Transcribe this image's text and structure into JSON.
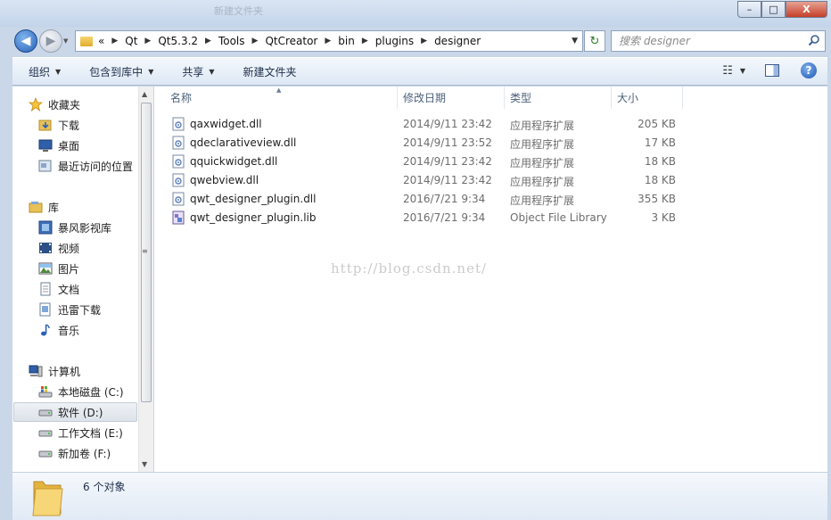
{
  "window": {
    "ghost_title": "新建文件夹",
    "minimize": "–",
    "maximize": "□",
    "close": "X"
  },
  "nav": {
    "back": "◀",
    "forward": "▶",
    "refresh": "↻",
    "crumbs": [
      "Qt",
      "Qt5.3.2",
      "Tools",
      "QtCreator",
      "bin",
      "plugins",
      "designer"
    ],
    "overflow": "«"
  },
  "search": {
    "placeholder": "搜索 designer"
  },
  "toolbar": {
    "organize": "组织",
    "include_in_library": "包含到库中",
    "share": "共享",
    "new_folder": "新建文件夹"
  },
  "sidebar": {
    "favorites_label": "收藏夹",
    "favorites": [
      "下载",
      "桌面",
      "最近访问的位置"
    ],
    "libraries_label": "库",
    "libraries": [
      "暴风影视库",
      "视频",
      "图片",
      "文档",
      "迅雷下载",
      "音乐"
    ],
    "computer_label": "计算机",
    "drives": [
      "本地磁盘 (C:)",
      "软件 (D:)",
      "工作文档 (E:)",
      "新加卷 (F:)"
    ]
  },
  "columns": {
    "name": "名称",
    "date": "修改日期",
    "type": "类型",
    "size": "大小"
  },
  "files": [
    {
      "name": "qaxwidget.dll",
      "date": "2014/9/11 23:42",
      "type": "应用程序扩展",
      "size": "205 KB",
      "icon": "dll-file-icon"
    },
    {
      "name": "qdeclarativeview.dll",
      "date": "2014/9/11 23:52",
      "type": "应用程序扩展",
      "size": "17 KB",
      "icon": "dll-file-icon"
    },
    {
      "name": "qquickwidget.dll",
      "date": "2014/9/11 23:42",
      "type": "应用程序扩展",
      "size": "18 KB",
      "icon": "dll-file-icon"
    },
    {
      "name": "qwebview.dll",
      "date": "2014/9/11 23:42",
      "type": "应用程序扩展",
      "size": "18 KB",
      "icon": "dll-file-icon"
    },
    {
      "name": "qwt_designer_plugin.dll",
      "date": "2016/7/21 9:34",
      "type": "应用程序扩展",
      "size": "355 KB",
      "icon": "dll-file-icon"
    },
    {
      "name": "qwt_designer_plugin.lib",
      "date": "2016/7/21 9:34",
      "type": "Object File Library",
      "size": "3 KB",
      "icon": "lib-file-icon"
    }
  ],
  "watermark": "http://blog.csdn.net/",
  "status": {
    "item_count": "6 个对象"
  },
  "colors": {
    "accent": "#2a62b7",
    "frame": "#c9d7e8"
  }
}
